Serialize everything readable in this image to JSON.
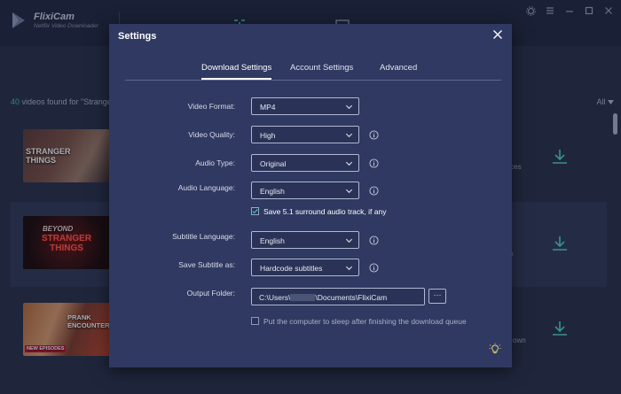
{
  "app": {
    "name": "FlixiCam",
    "subtitle": "Netflix Video Downloader"
  },
  "results": {
    "count": "40",
    "text": " videos found for \"Strange",
    "filter": "All"
  },
  "rows": [
    {
      "thumb_text": "STRANGER THINGS",
      "snippet": "orces"
    },
    {
      "thumb_text": "STRANGER THINGS",
      "thumb_text_top": "BEYOND",
      "snippet": "m"
    },
    {
      "thumb_text": "PRANK ENCOUNTER",
      "thumb_badge": "NEW EPISODES",
      "snippet": "own"
    }
  ],
  "dialog": {
    "title": "Settings",
    "tabs": [
      {
        "label": "Download Settings",
        "active": true
      },
      {
        "label": "Account Settings",
        "active": false
      },
      {
        "label": "Advanced",
        "active": false
      }
    ],
    "fields": {
      "video_format": {
        "label": "Video Format:",
        "value": "MP4"
      },
      "video_quality": {
        "label": "Video Quality:",
        "value": "High"
      },
      "audio_type": {
        "label": "Audio Type:",
        "value": "Original"
      },
      "audio_language": {
        "label": "Audio Language:",
        "value": "English"
      },
      "surround": {
        "label": "Save 5.1 surround audio track, if any",
        "checked": true
      },
      "subtitle_language": {
        "label": "Subtitle Language:",
        "value": "English"
      },
      "save_subtitle": {
        "label": "Save Subtitle as:",
        "value": "Hardcode subtitles"
      },
      "output_folder": {
        "label": "Output Folder:",
        "path_prefix": "C:\\Users\\",
        "path_suffix": "\\Documents\\FlixiCam",
        "browse_label": "···"
      },
      "sleep": {
        "label": "Put the computer to sleep after finishing the download queue",
        "checked": false
      }
    }
  },
  "colors": {
    "accent": "#2ec4b6",
    "dialog_bg": "#2f3961",
    "app_bg": "#27304b"
  }
}
